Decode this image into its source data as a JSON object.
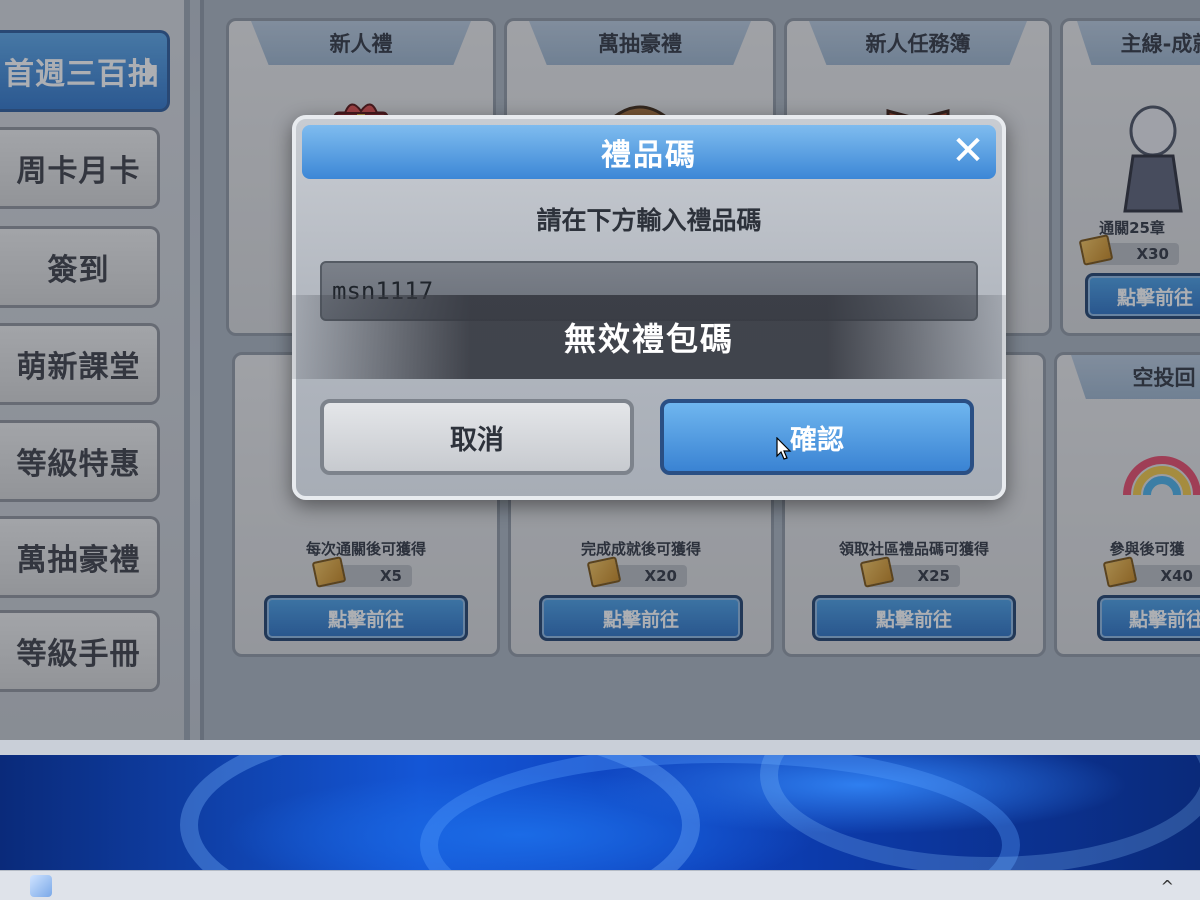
{
  "sidebar": {
    "items": [
      {
        "label": "首週三百抽",
        "active": true
      },
      {
        "label": "周卡月卡"
      },
      {
        "label": "簽到"
      },
      {
        "label": "萌新課堂"
      },
      {
        "label": "等級特惠"
      },
      {
        "label": "萬抽豪禮"
      },
      {
        "label": "等級手冊"
      }
    ]
  },
  "cards": {
    "top": [
      {
        "title": "新人禮"
      },
      {
        "title": "萬抽豪禮"
      },
      {
        "title": "新人任務簿"
      },
      {
        "title": "主線-成就",
        "desc": "通關25章",
        "reward": "X30",
        "button": "點擊前往"
      }
    ],
    "bottom": [
      {
        "desc": "每次通關後可獲得",
        "reward": "X5",
        "button": "點擊前往"
      },
      {
        "desc": "完成成就後可獲得",
        "reward": "X20",
        "button": "點擊前往"
      },
      {
        "desc": "領取社區禮品碼可獲得",
        "reward": "X25",
        "button": "點擊前往"
      },
      {
        "title": "空投回",
        "desc": "參與後可獲",
        "reward": "X40",
        "button": "點擊前往"
      }
    ]
  },
  "dialog": {
    "title": "禮品碼",
    "prompt": "請在下方輸入禮品碼",
    "input_value": "msn1117",
    "toast": "無效禮包碼",
    "cancel_label": "取消",
    "confirm_label": "確認"
  },
  "icons": {
    "close": "close-icon",
    "chevron": "chevron-right-icon",
    "ticket": "ticket-icon",
    "cursor": "mouse-cursor-icon"
  },
  "colors": {
    "accent_blue": "#3c87d6",
    "panel_gray": "#b4b9c1"
  }
}
